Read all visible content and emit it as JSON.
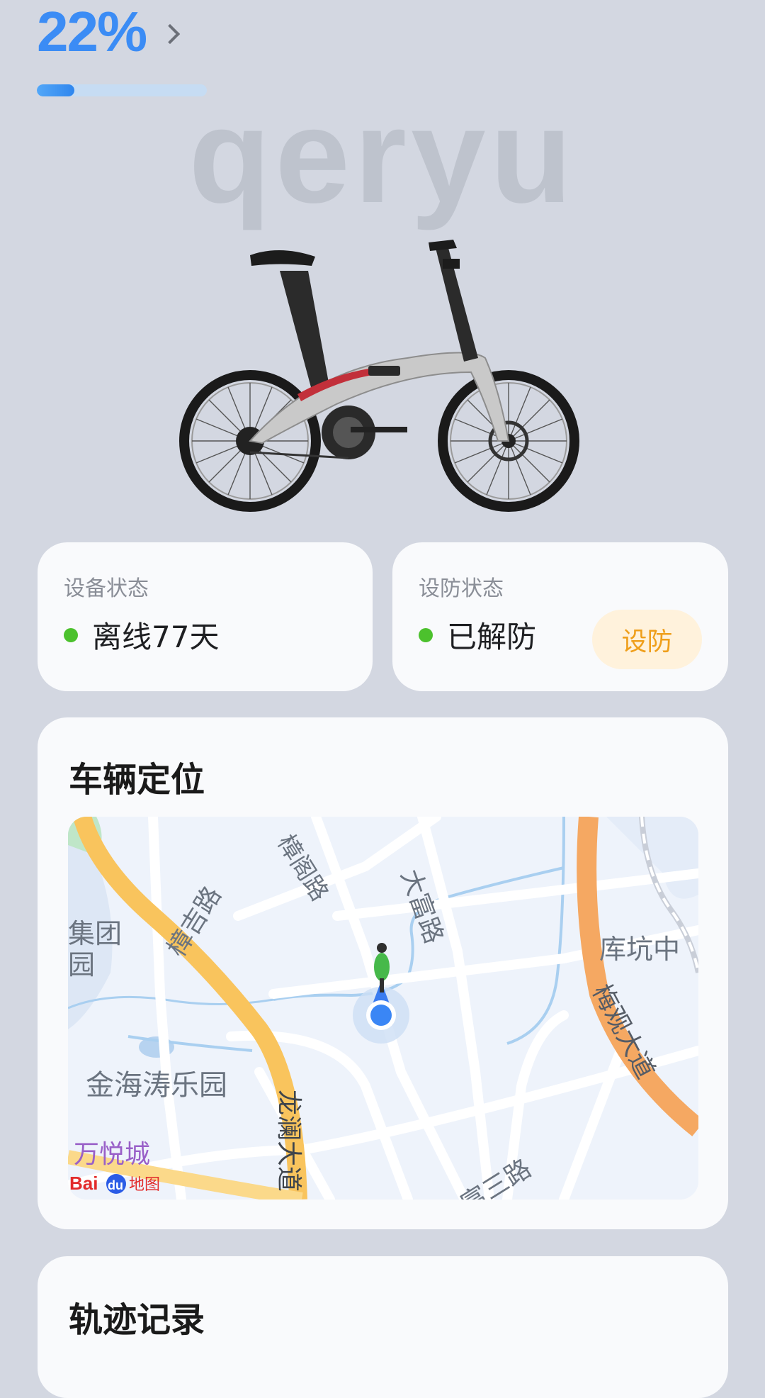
{
  "battery": {
    "percent_label": "22%",
    "level": 0.22
  },
  "brand": {
    "watermark": "qeryu"
  },
  "device_status": {
    "label": "设备状态",
    "value": "离线77天",
    "status_color": "#4cc12d"
  },
  "defense_status": {
    "label": "设防状态",
    "value": "已解防",
    "status_color": "#4cc12d",
    "action_label": "设防"
  },
  "location": {
    "title": "车辆定位",
    "map": {
      "labels": {
        "zhangjige": "樟吉路",
        "zhangge": "樟阁路",
        "dafu": "大富路",
        "kukeng": "库坑中",
        "meiguan": "梅观大道",
        "longlan": "龙澜大道",
        "jinhai": "金海涛乐园",
        "jituan_a": "集团",
        "jituan_b": "园",
        "wanyue": "万悦城",
        "fusan": "富三路",
        "logo_bai": "Bai",
        "logo_du": "du",
        "logo_ditu": "地图"
      }
    }
  },
  "track": {
    "title": "轨迹记录"
  }
}
